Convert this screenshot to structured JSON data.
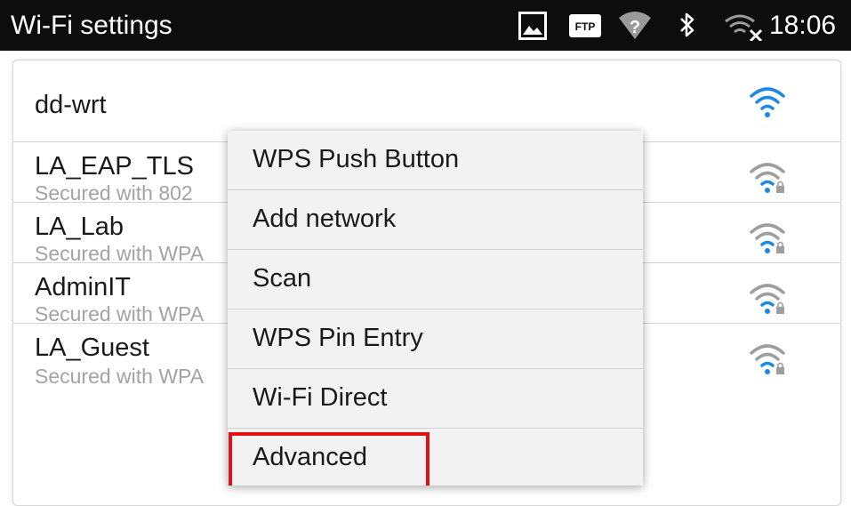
{
  "statusbar": {
    "title": "Wi-Fi settings",
    "time": "18:06",
    "icons": [
      "image-icon",
      "ftp-icon",
      "wifi-unknown-icon",
      "bluetooth-icon",
      "wifi-disconnected-icon"
    ],
    "ftp_label": "FTP",
    "unknown_glyph": "?"
  },
  "networks": [
    {
      "ssid": "dd-wrt",
      "security": "",
      "signal_color": "#1e88e5",
      "locked": false
    },
    {
      "ssid": "LA_EAP_TLS",
      "security": "Secured with 802",
      "signal_color": "#9e9e9e",
      "locked": true
    },
    {
      "ssid": "LA_Lab",
      "security": "Secured with WPA",
      "signal_color": "#9e9e9e",
      "locked": true
    },
    {
      "ssid": "AdminIT",
      "security": "Secured with WPA",
      "signal_color": "#9e9e9e",
      "locked": true
    },
    {
      "ssid": "LA_Guest",
      "security": "Secured with WPA",
      "signal_color": "#9e9e9e",
      "locked": true
    }
  ],
  "menu": {
    "items": [
      "WPS Push Button",
      "Add network",
      "Scan",
      "WPS Pin Entry",
      "Wi-Fi Direct",
      "Advanced"
    ],
    "highlighted": "Advanced",
    "highlight_color": "#e21212"
  },
  "colors": {
    "statusbar_bg": "#0d0d0d",
    "wifi_active": "#1e88e5",
    "wifi_inactive": "#9e9e9e",
    "secondary_text": "#a3a3a3"
  }
}
